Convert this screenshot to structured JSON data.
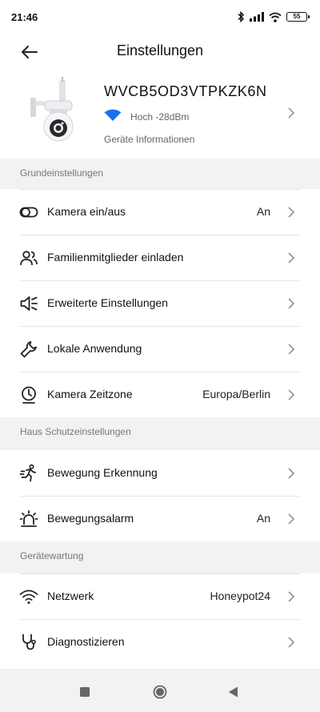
{
  "status_bar": {
    "time": "21:46",
    "battery": "55"
  },
  "header": {
    "title": "Einstellungen"
  },
  "device": {
    "name": "WVCB5OD3VTPKZK6N",
    "signal": "Hoch -28dBm",
    "info_link": "Geräte Informationen",
    "wifi_color": "#1d6ff2"
  },
  "sections": {
    "basic": "Grundeinstellungen",
    "protection": "Haus Schutzeinstellungen",
    "maintenance": "Gerätewartung"
  },
  "rows": {
    "camera_toggle": {
      "label": "Kamera ein/aus",
      "value": "An",
      "icon": "toggle-icon"
    },
    "invite": {
      "label": "Familienmitglieder einladen",
      "icon": "people-icon"
    },
    "advanced": {
      "label": "Erweiterte Einstellungen",
      "icon": "speaker-icon"
    },
    "local": {
      "label": "Lokale Anwendung",
      "icon": "wrench-icon"
    },
    "timezone": {
      "label": "Kamera Zeitzone",
      "value": "Europa/Berlin",
      "icon": "clock-pin-icon"
    },
    "motion": {
      "label": "Bewegung Erkennung",
      "icon": "running-person-icon"
    },
    "alarm": {
      "label": "Bewegungsalarm",
      "value": "An",
      "icon": "alarm-light-icon"
    },
    "network": {
      "label": "Netzwerk",
      "value": "Honeypot24",
      "icon": "wifi-icon"
    },
    "diagnose": {
      "label": "Diagnostizieren",
      "icon": "stethoscope-icon"
    }
  }
}
